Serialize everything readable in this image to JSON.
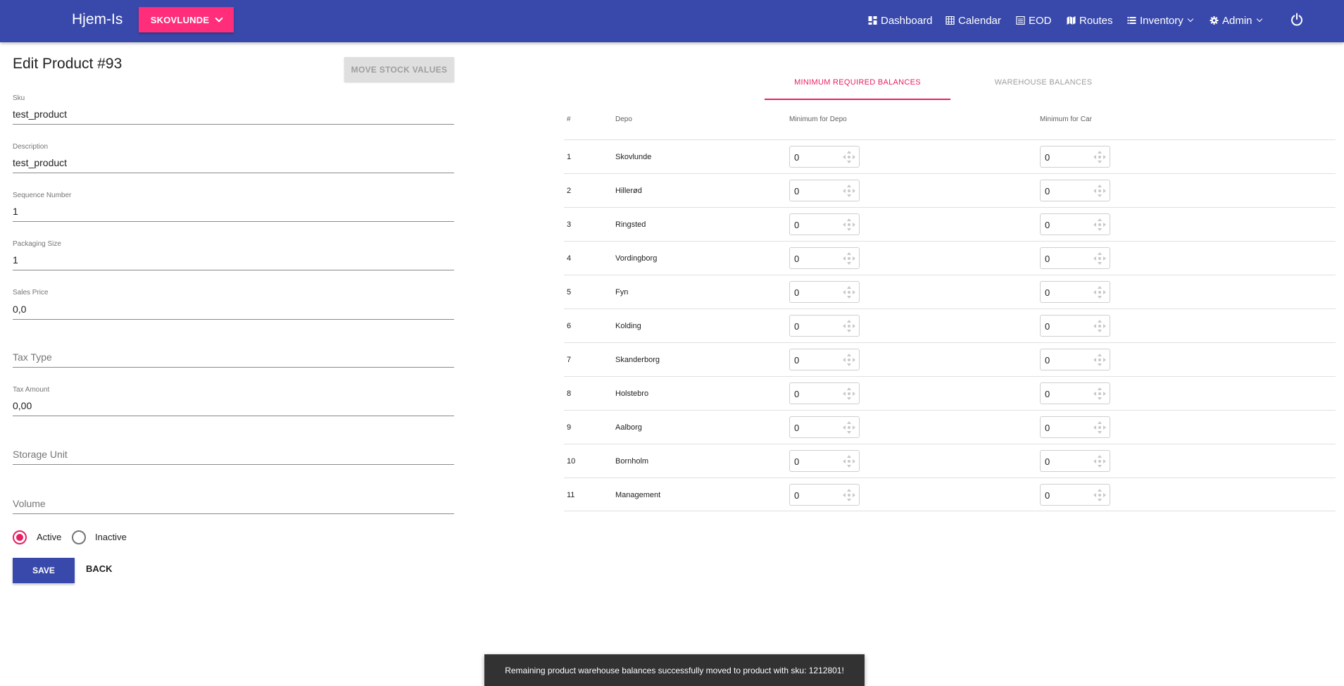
{
  "header": {
    "brand": "Hjem-Is",
    "depot_selector": "SKOVLUNDE",
    "nav": {
      "dashboard": "Dashboard",
      "calendar": "Calendar",
      "eod": "EOD",
      "routes": "Routes",
      "inventory": "Inventory",
      "admin": "Admin"
    },
    "colors": {
      "primary": "#3949ab",
      "accent": "#ff2d7a"
    }
  },
  "form": {
    "title": "Edit Product #93",
    "move_button": "MOVE STOCK VALUES",
    "fields": {
      "sku": {
        "label": "Sku",
        "value": "test_product"
      },
      "description": {
        "label": "Description",
        "value": "test_product"
      },
      "sequence": {
        "label": "Sequence Number",
        "value": "1"
      },
      "packaging": {
        "label": "Packaging Size",
        "value": "1"
      },
      "sales_price": {
        "label": "Sales Price",
        "value": "0,0"
      },
      "tax_type": {
        "placeholder": "Tax Type"
      },
      "tax_amount": {
        "label": "Tax Amount",
        "value": "0,00"
      },
      "storage_unit": {
        "placeholder": "Storage Unit"
      },
      "volume": {
        "placeholder": "Volume"
      }
    },
    "status": {
      "active": "Active",
      "inactive": "Inactive",
      "selected": "Active"
    },
    "save": "SAVE",
    "back": "BACK"
  },
  "tabs": {
    "minimum": "MINIMUM REQUIRED BALANCES",
    "warehouse": "WAREHOUSE BALANCES",
    "active": "minimum"
  },
  "table": {
    "headers": {
      "num": "#",
      "depo": "Depo",
      "min_depo": "Minimum for Depo",
      "min_car": "Minimum for Car"
    },
    "rows": [
      {
        "num": "1",
        "depo": "Skovlunde",
        "min_depo": "0",
        "min_car": "0"
      },
      {
        "num": "2",
        "depo": "Hillerød",
        "min_depo": "0",
        "min_car": "0"
      },
      {
        "num": "3",
        "depo": "Ringsted",
        "min_depo": "0",
        "min_car": "0"
      },
      {
        "num": "4",
        "depo": "Vordingborg",
        "min_depo": "0",
        "min_car": "0"
      },
      {
        "num": "5",
        "depo": "Fyn",
        "min_depo": "0",
        "min_car": "0"
      },
      {
        "num": "6",
        "depo": "Kolding",
        "min_depo": "0",
        "min_car": "0"
      },
      {
        "num": "7",
        "depo": "Skanderborg",
        "min_depo": "0",
        "min_car": "0"
      },
      {
        "num": "8",
        "depo": "Holstebro",
        "min_depo": "0",
        "min_car": "0"
      },
      {
        "num": "9",
        "depo": "Aalborg",
        "min_depo": "0",
        "min_car": "0"
      },
      {
        "num": "10",
        "depo": "Bornholm",
        "min_depo": "0",
        "min_car": "0"
      },
      {
        "num": "11",
        "depo": "Management",
        "min_depo": "0",
        "min_car": "0"
      }
    ]
  },
  "snackbar": "Remaining product warehouse balances successfully moved to product with sku: 1212801!"
}
